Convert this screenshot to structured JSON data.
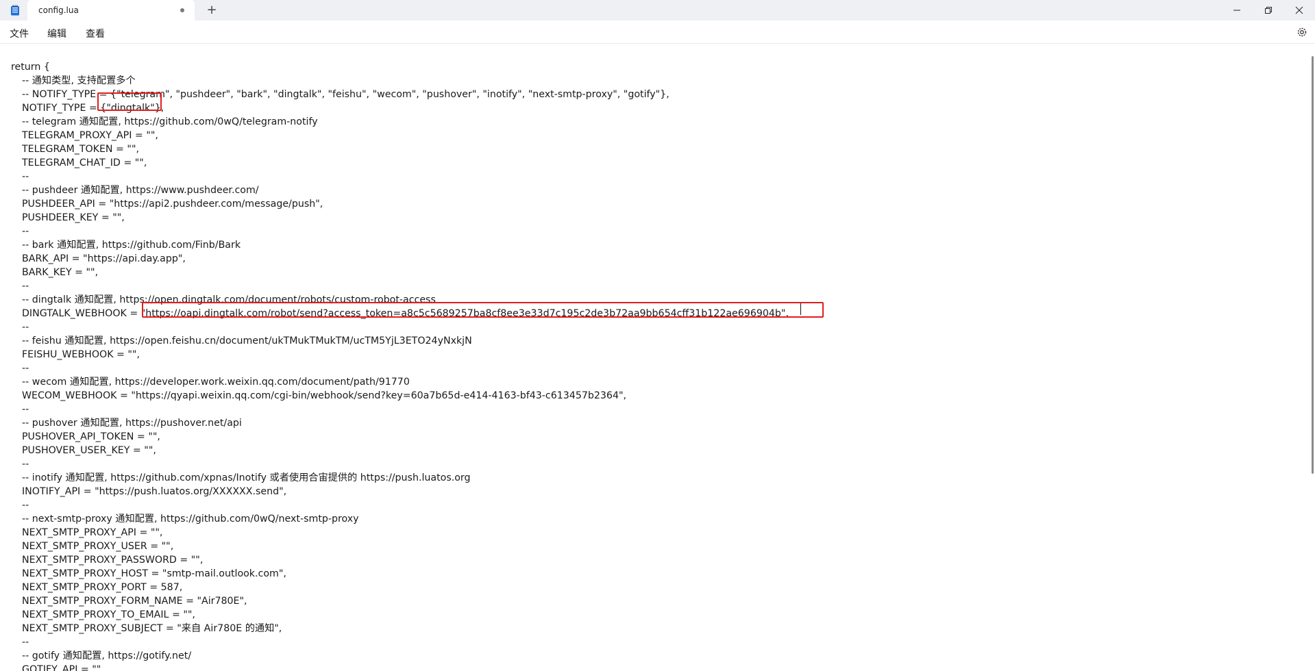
{
  "tab": {
    "title": "config.lua"
  },
  "menu": {
    "file": "文件",
    "edit": "编辑",
    "view": "查看"
  },
  "icons": {
    "app": "notepad-icon",
    "modified": "unsaved-dot-icon",
    "new_tab": "plus-icon",
    "minimize": "minimize-icon",
    "maximize": "restore-icon",
    "close": "close-icon",
    "settings": "gear-icon"
  },
  "new_tab_glyph": "+",
  "highlight_color": "#e11d1d",
  "lines": [
    "return {",
    "-- 通知类型, 支持配置多个",
    "-- NOTIFY_TYPE = {\"telegram\", \"pushdeer\", \"bark\", \"dingtalk\", \"feishu\", \"wecom\", \"pushover\", \"inotify\", \"next-smtp-proxy\", \"gotify\"},",
    "NOTIFY_TYPE = {\"dingtalk\"},",
    "-- telegram 通知配置, https://github.com/0wQ/telegram-notify",
    "TELEGRAM_PROXY_API = \"\",",
    "TELEGRAM_TOKEN = \"\",",
    "TELEGRAM_CHAT_ID = \"\",",
    "--",
    "-- pushdeer 通知配置, https://www.pushdeer.com/",
    "PUSHDEER_API = \"https://api2.pushdeer.com/message/push\",",
    "PUSHDEER_KEY = \"\",",
    "--",
    "-- bark 通知配置, https://github.com/Finb/Bark",
    "BARK_API = \"https://api.day.app\",",
    "BARK_KEY = \"\",",
    "--",
    "-- dingtalk 通知配置, https://open.dingtalk.com/document/robots/custom-robot-access",
    "DINGTALK_WEBHOOK = \"https://oapi.dingtalk.com/robot/send?access_token=a8c5c5689257ba8cf8ee3e33d7c195c2de3b72aa9bb654cff31b122ae696904b\",",
    "--",
    "-- feishu 通知配置, https://open.feishu.cn/document/ukTMukTMukTM/ucTM5YjL3ETO24yNxkjN",
    "FEISHU_WEBHOOK = \"\",",
    "--",
    "-- wecom 通知配置, https://developer.work.weixin.qq.com/document/path/91770",
    "WECOM_WEBHOOK = \"https://qyapi.weixin.qq.com/cgi-bin/webhook/send?key=60a7b65d-e414-4163-bf43-c613457b2364\",",
    "--",
    "-- pushover 通知配置, https://pushover.net/api",
    "PUSHOVER_API_TOKEN = \"\",",
    "PUSHOVER_USER_KEY = \"\",",
    "--",
    "-- inotify 通知配置, https://github.com/xpnas/Inotify 或者使用合宙提供的 https://push.luatos.org",
    "INOTIFY_API = \"https://push.luatos.org/XXXXXX.send\",",
    "--",
    "-- next-smtp-proxy 通知配置, https://github.com/0wQ/next-smtp-proxy",
    "NEXT_SMTP_PROXY_API = \"\",",
    "NEXT_SMTP_PROXY_USER = \"\",",
    "NEXT_SMTP_PROXY_PASSWORD = \"\",",
    "NEXT_SMTP_PROXY_HOST = \"smtp-mail.outlook.com\",",
    "NEXT_SMTP_PROXY_PORT = 587,",
    "NEXT_SMTP_PROXY_FORM_NAME = \"Air780E\",",
    "NEXT_SMTP_PROXY_TO_EMAIL = \"\",",
    "NEXT_SMTP_PROXY_SUBJECT = \"来自 Air780E 的通知\",",
    "--",
    "-- gotify 通知配置, https://gotify.net/",
    "GOTIFY_API = \"\","
  ]
}
